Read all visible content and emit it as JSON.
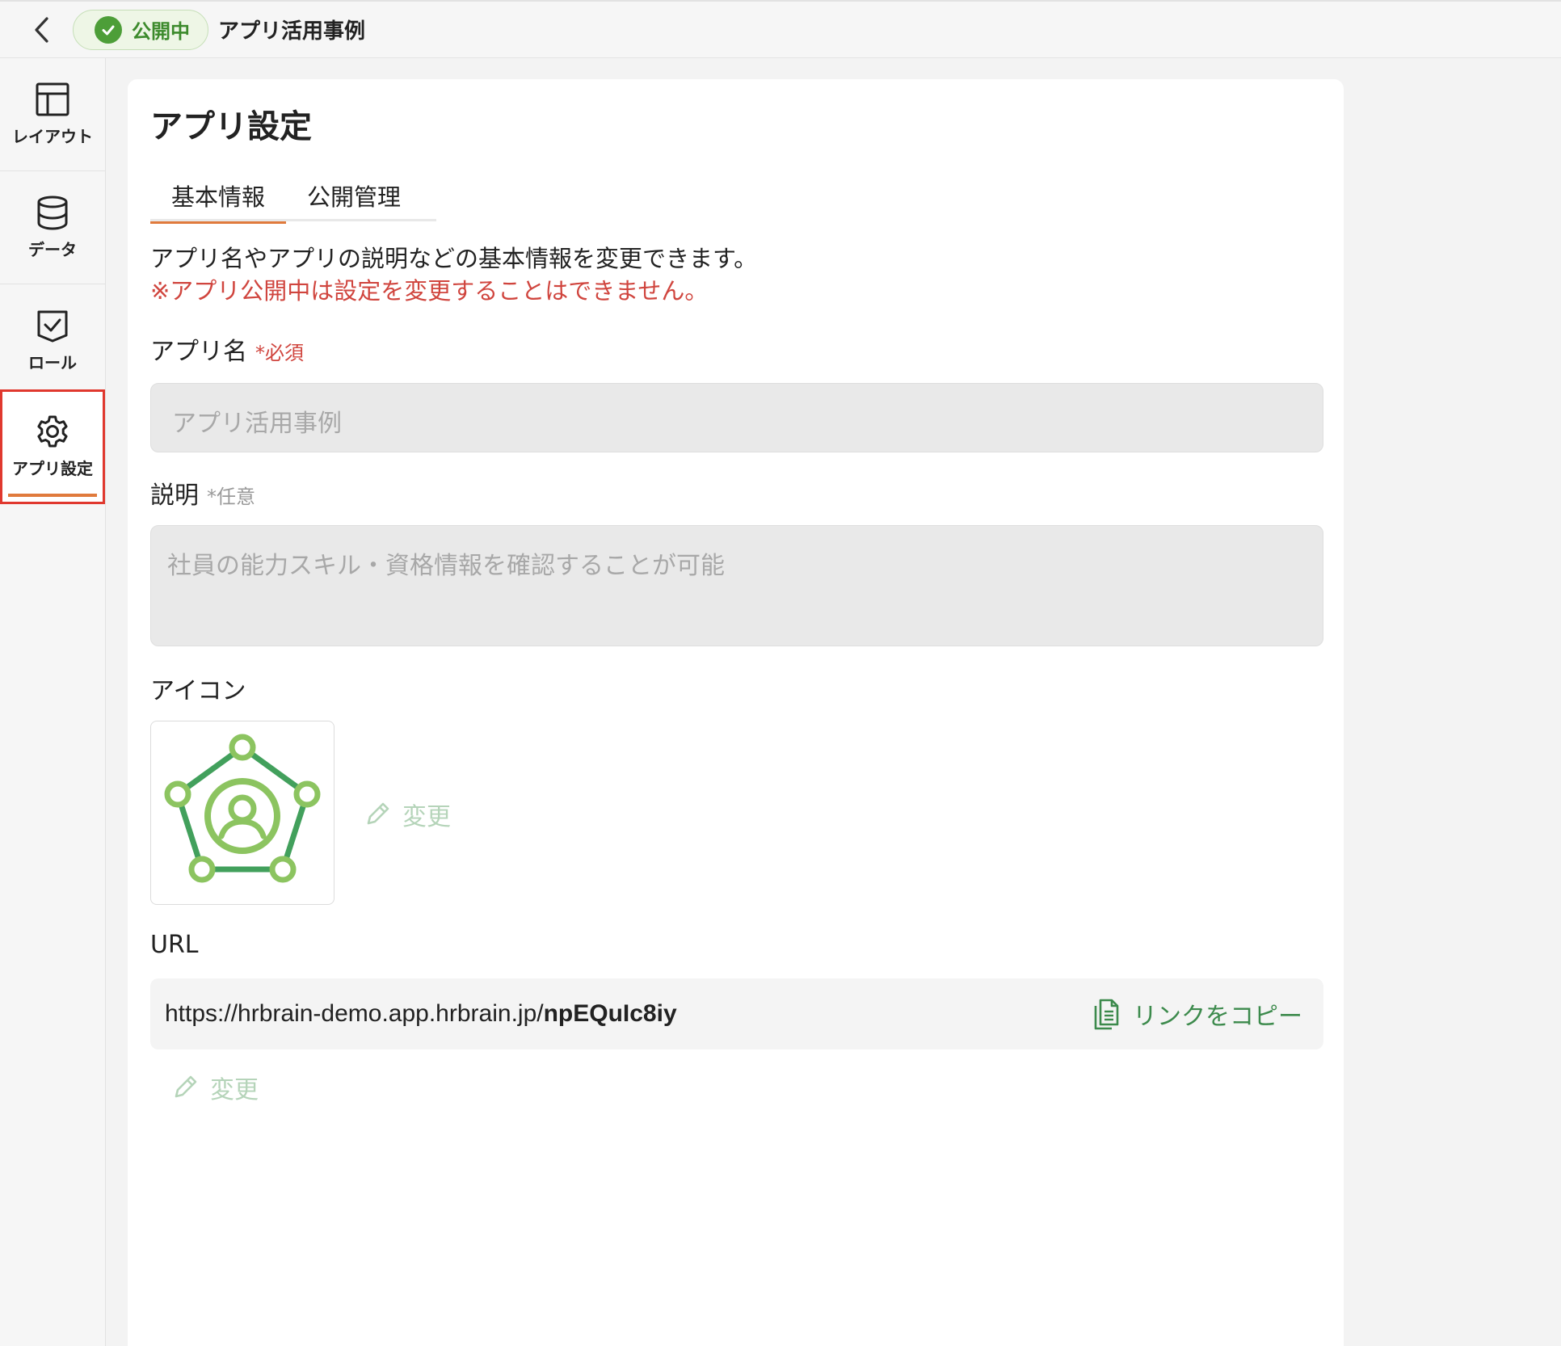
{
  "header": {
    "status_label": "公開中",
    "app_name": "アプリ活用事例"
  },
  "sidebar": {
    "items": [
      {
        "label": "レイアウト",
        "icon": "layout-icon"
      },
      {
        "label": "データ",
        "icon": "database-icon"
      },
      {
        "label": "ロール",
        "icon": "role-check-icon"
      },
      {
        "label": "アプリ設定",
        "icon": "gear-icon",
        "active": true
      }
    ]
  },
  "main": {
    "title": "アプリ設定",
    "tabs": [
      {
        "label": "基本情報",
        "active": true
      },
      {
        "label": "公開管理",
        "active": false
      }
    ],
    "description": "アプリ名やアプリの説明などの基本情報を変更できます。",
    "notice": "※アプリ公開中は設定を変更することはできません。",
    "app_name_field": {
      "label": "アプリ名",
      "required": "*必須",
      "value": "アプリ活用事例"
    },
    "description_field": {
      "label": "説明",
      "optional": "*任意",
      "value": "社員の能力スキル・資格情報を確認することが可能"
    },
    "icon_field": {
      "label": "アイコン",
      "change_label": "変更"
    },
    "url_field": {
      "label": "URL",
      "base": "https://hrbrain-demo.app.hrbrain.jp/",
      "slug": "npEQuIc8iy",
      "copy_label": "リンクをコピー",
      "change_label": "変更"
    }
  },
  "colors": {
    "accent": "#e07a3c",
    "status_green": "#4d9e38",
    "notice_red": "#d0453e",
    "highlight_red": "#e0382e",
    "link_green": "#3c8a4c"
  }
}
